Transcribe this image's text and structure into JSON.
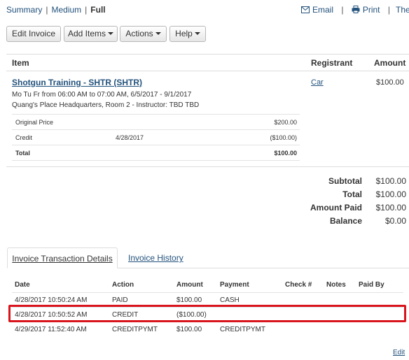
{
  "view_links": {
    "summary": "Summary",
    "medium": "Medium",
    "full": "Full",
    "separator": "|"
  },
  "top_actions": {
    "email": "Email",
    "print": "Print",
    "thermal": "Thermal"
  },
  "toolbar": {
    "edit_invoice": "Edit Invoice",
    "add_items": "Add Items",
    "actions": "Actions",
    "help": "Help"
  },
  "items_table": {
    "headers": {
      "item": "Item",
      "registrant": "Registrant",
      "amount": "Amount"
    },
    "item": {
      "title": "Shotgun Training - SHTR  (SHTR)",
      "schedule": "Mo Tu Fr from 06:00 AM to 07:00 AM, 6/5/2017 - 9/1/2017",
      "location": "Quang's Place Headquarters, Room 2 - Instructor: TBD TBD",
      "registrant": "Car",
      "amount": "$100.00",
      "price_rows": [
        {
          "label": "Original Price",
          "date": "",
          "amount": "$200.00"
        },
        {
          "label": "Credit",
          "date": "4/28/2017",
          "amount": "($100.00)"
        },
        {
          "label": "Total",
          "date": "",
          "amount": "$100.00"
        }
      ]
    }
  },
  "totals": [
    {
      "label": "Subtotal",
      "value": "$100.00"
    },
    {
      "label": "Total",
      "value": "$100.00"
    },
    {
      "label": "Amount Paid",
      "value": "$100.00"
    },
    {
      "label": "Balance",
      "value": "$0.00"
    }
  ],
  "tabs": {
    "transaction_details": "Invoice Transaction Details",
    "history": "Invoice History"
  },
  "transactions": {
    "headers": {
      "date": "Date",
      "action": "Action",
      "amount": "Amount",
      "payment": "Payment",
      "check": "Check #",
      "notes": "Notes",
      "paid_by": "Paid By"
    },
    "rows": [
      {
        "date": "4/28/2017 10:50:24 AM",
        "action": "PAID",
        "amount": "$100.00",
        "payment": "CASH"
      },
      {
        "date": "4/28/2017 10:50:52 AM",
        "action": "CREDIT",
        "amount": "($100.00)",
        "payment": ""
      },
      {
        "date": "4/29/2017 11:52:40 AM",
        "action": "CREDITPYMT",
        "amount": "$100.00",
        "payment": "CREDITPYMT"
      }
    ]
  },
  "edit_link": "Edit",
  "colors": {
    "link": "#23527c",
    "highlight": "#d9141c"
  },
  "icons": {
    "email": "envelope-icon",
    "print": "printer-icon"
  }
}
